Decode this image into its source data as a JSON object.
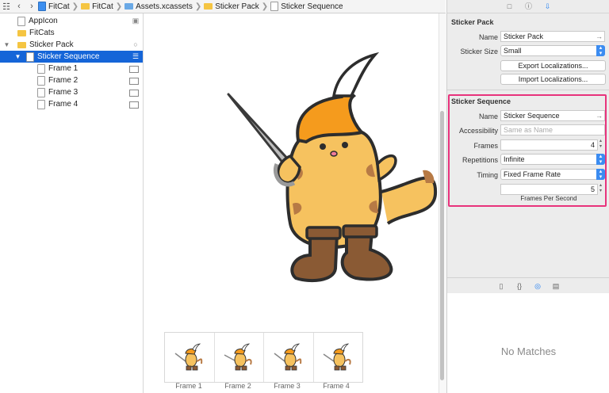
{
  "jumpbar": {
    "crumbs": [
      "FitCat",
      "FitCat",
      "Assets.xcassets",
      "Sticker Pack",
      "Sticker Sequence"
    ]
  },
  "navigator": {
    "items": [
      {
        "label": "AppIcon"
      },
      {
        "label": "FitCats"
      },
      {
        "label": "Sticker Pack"
      },
      {
        "label": "Sticker Sequence"
      },
      {
        "label": "Frame 1"
      },
      {
        "label": "Frame 2"
      },
      {
        "label": "Frame 3"
      },
      {
        "label": "Frame 4"
      }
    ]
  },
  "canvas": {
    "frames": [
      "Frame 1",
      "Frame 2",
      "Frame 3",
      "Frame 4"
    ]
  },
  "inspector": {
    "sticker_pack": {
      "title": "Sticker Pack",
      "name_label": "Name",
      "name_value": "Sticker Pack",
      "size_label": "Sticker Size",
      "size_value": "Small",
      "export_button": "Export Localizations...",
      "import_button": "Import Localizations..."
    },
    "sticker_sequence": {
      "title": "Sticker Sequence",
      "name_label": "Name",
      "name_value": "Sticker Sequence",
      "accessibility_label": "Accessibility",
      "accessibility_placeholder": "Same as Name",
      "frames_label": "Frames",
      "frames_value": "4",
      "repetitions_label": "Repetitions",
      "repetitions_value": "Infinite",
      "timing_label": "Timing",
      "timing_value": "Fixed Frame Rate",
      "fps_value": "5",
      "fps_caption": "Frames Per Second"
    },
    "library": {
      "empty_text": "No Matches"
    }
  },
  "colors": {
    "selection": "#1565d8",
    "highlight": "#e8337c",
    "accent": "#3b8cf1"
  }
}
